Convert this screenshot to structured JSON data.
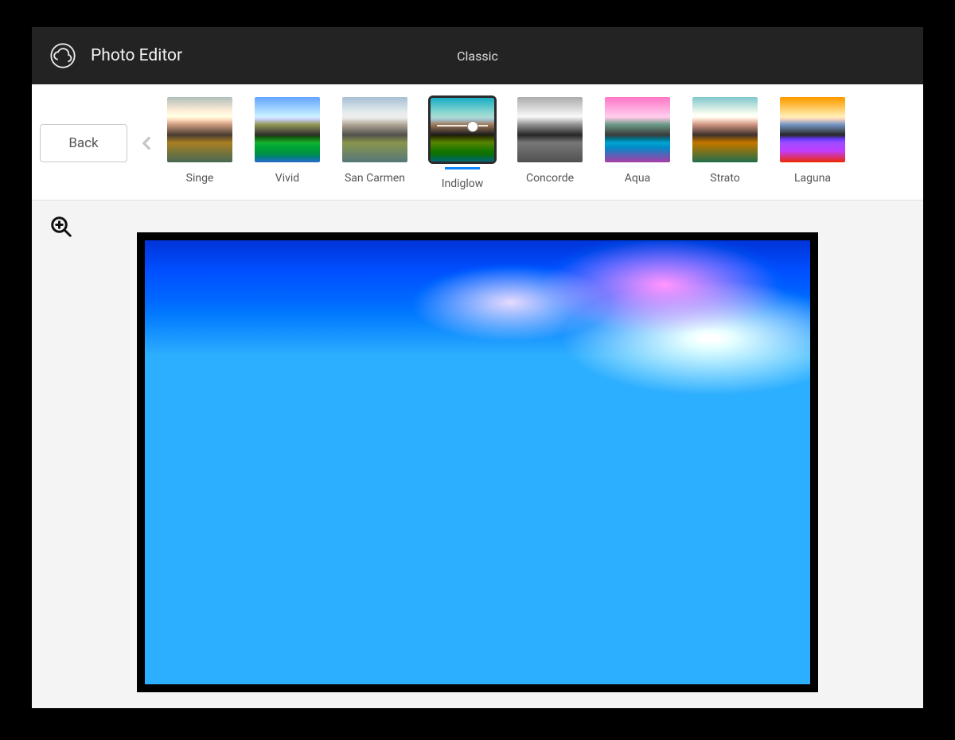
{
  "header": {
    "app_title": "Photo Editor",
    "center_label": "Classic"
  },
  "toolbar": {
    "back_label": "Back"
  },
  "filters": {
    "selected_index": 3,
    "items": [
      {
        "label": "Singe",
        "thumb_class": "t-singe"
      },
      {
        "label": "Vivid",
        "thumb_class": "t-vivid"
      },
      {
        "label": "San Carmen",
        "thumb_class": "t-sancarmen"
      },
      {
        "label": "Indiglow",
        "thumb_class": "t-indiglow"
      },
      {
        "label": "Concorde",
        "thumb_class": "t-concorde"
      },
      {
        "label": "Aqua",
        "thumb_class": "t-aqua"
      },
      {
        "label": "Strato",
        "thumb_class": "t-strato"
      },
      {
        "label": "Laguna",
        "thumb_class": "t-laguna"
      }
    ]
  },
  "icons": {
    "logo": "creative-cloud",
    "zoom": "zoom-in",
    "chevron_left": "chevron-left"
  },
  "colors": {
    "accent": "#0a84ff",
    "header_bg": "#232323"
  }
}
